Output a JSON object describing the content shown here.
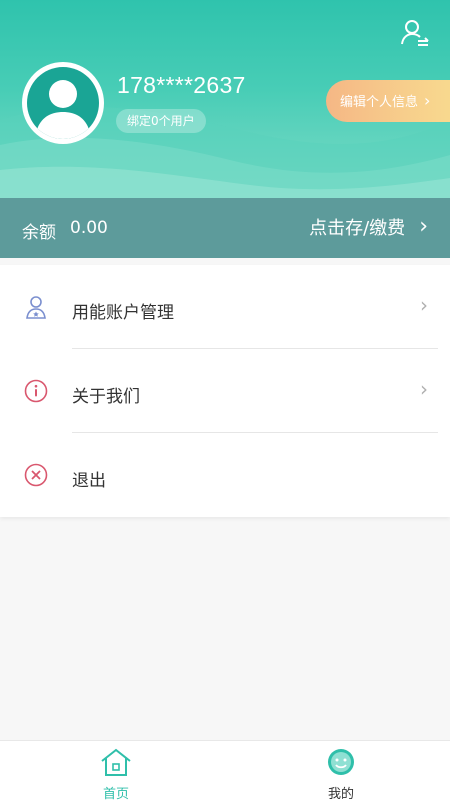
{
  "header": {
    "phone": "178****2637",
    "bind_badge": "绑定0个用户",
    "edit_profile": "编辑个人信息",
    "edit_chevron": "›"
  },
  "balance": {
    "label": "余额",
    "value": "0.00",
    "action": "点击存/缴费",
    "chevron": "›"
  },
  "menu": {
    "items": [
      {
        "label": "用能账户管理",
        "icon": "user-account-icon",
        "arrow": "›"
      },
      {
        "label": "关于我们",
        "icon": "info-icon",
        "arrow": "›"
      },
      {
        "label": "退出",
        "icon": "close-circle-icon"
      }
    ]
  },
  "tabbar": {
    "tabs": [
      {
        "label": "首页",
        "icon": "home-icon"
      },
      {
        "label": "我的",
        "icon": "smiley-icon"
      }
    ]
  },
  "colors": {
    "primary": "#2fc3ad",
    "balance_bar": "#5d9b9b",
    "edit_gradient_start": "#f5b785",
    "edit_gradient_end": "#f9dc8f",
    "icon_blue": "#7b8fcf",
    "icon_red": "#d9576e",
    "tab_active": "#2fbfaa"
  }
}
